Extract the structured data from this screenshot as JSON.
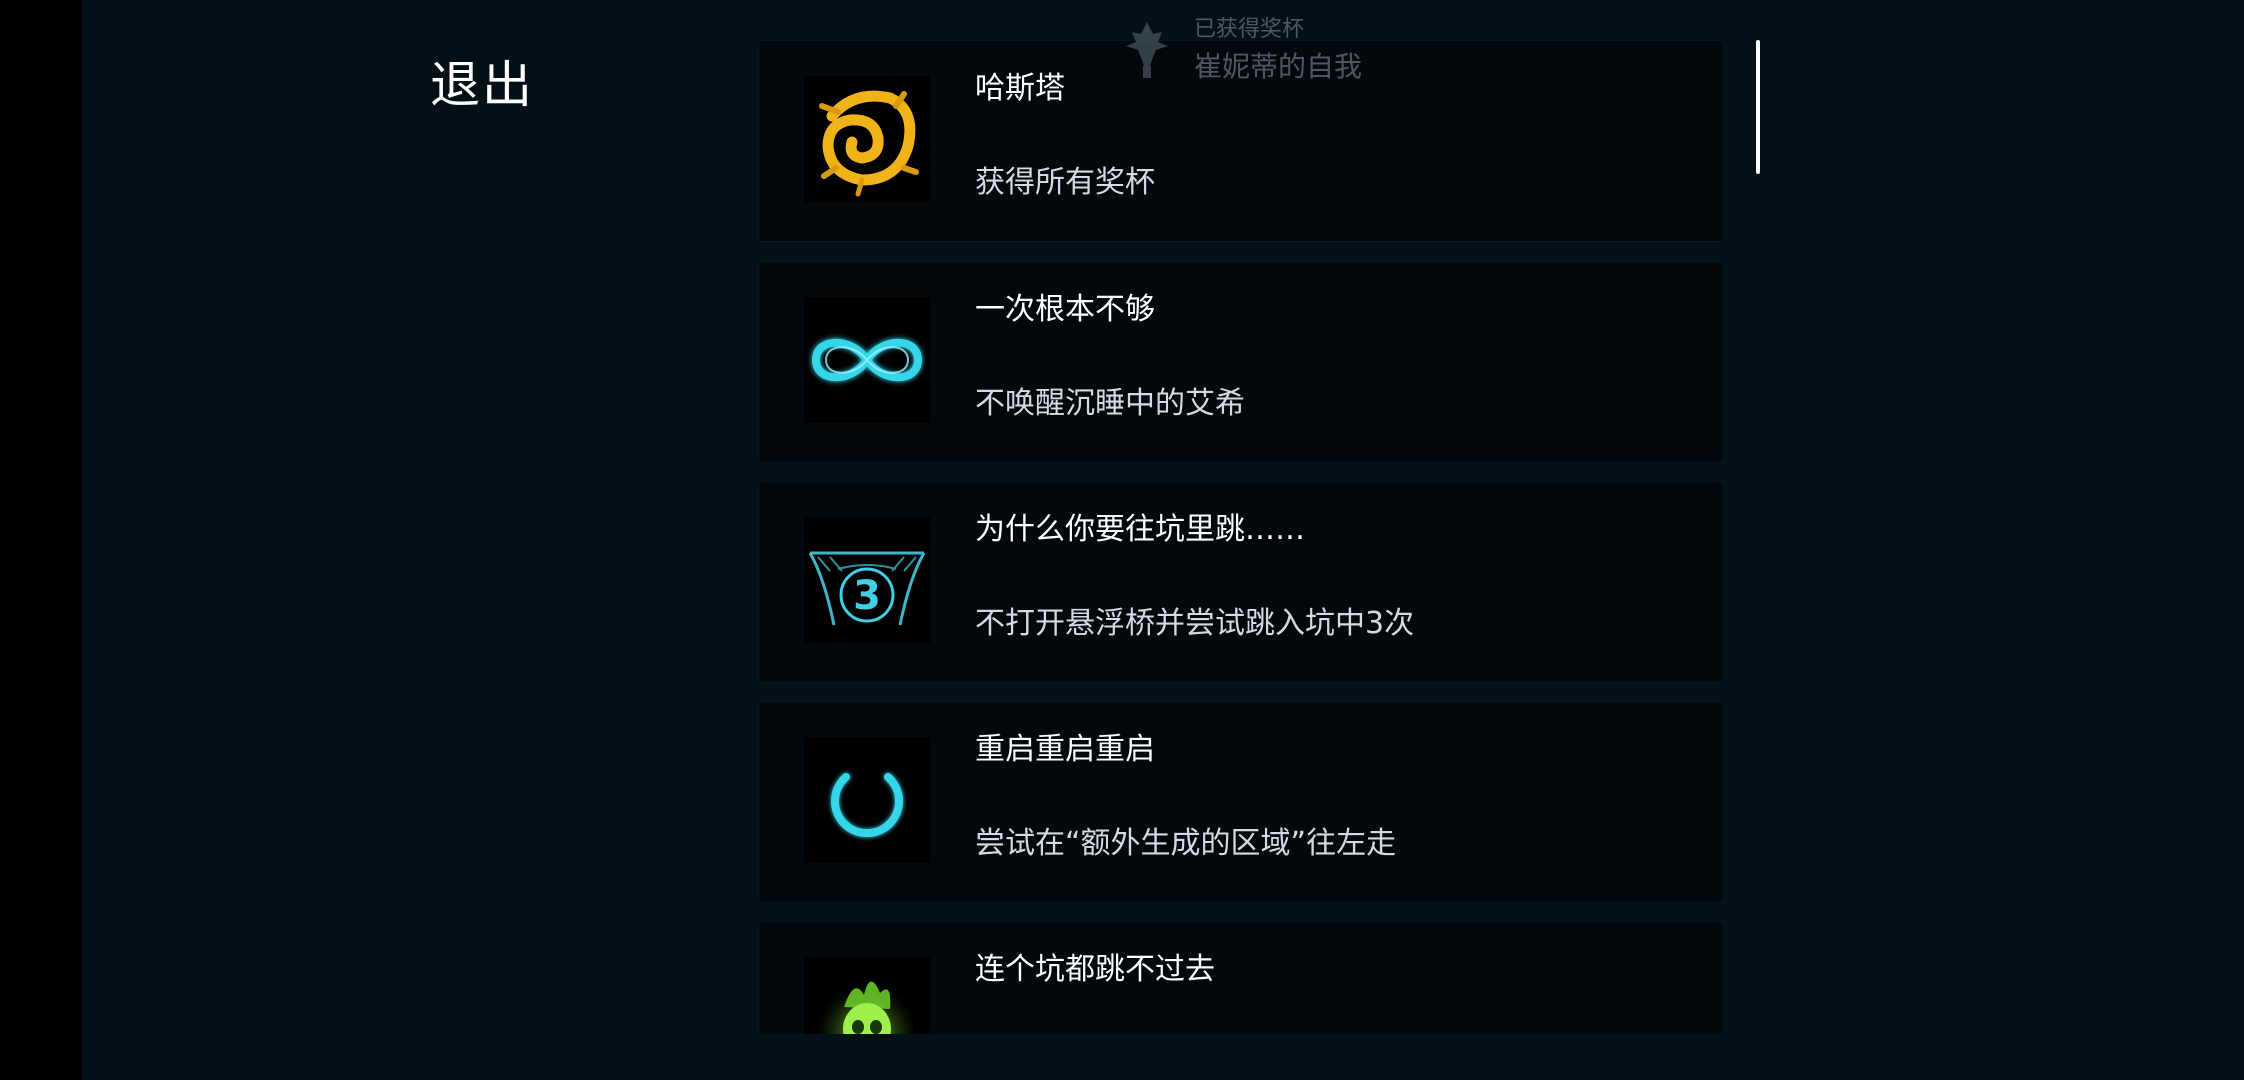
{
  "menu": {
    "exit_label": "退出"
  },
  "toast": {
    "caption": "已获得奖杯",
    "name": "崔妮蒂的自我"
  },
  "achievements": [
    {
      "title": "哈斯塔",
      "description": "获得所有奖杯",
      "icon": "golden-spiral-emblem-icon"
    },
    {
      "title": "一次根本不够",
      "description": "不唤醒沉睡中的艾希",
      "icon": "glowing-infinity-icon"
    },
    {
      "title": "为什么你要往坑里跳……",
      "description": "不打开悬浮桥并尝试跳入坑中3次",
      "icon": "bridge-pit-three-icon",
      "icon_text": "3"
    },
    {
      "title": "重启重启重启",
      "description": "尝试在“额外生成的区域”往左走",
      "icon": "power-button-icon"
    },
    {
      "title": "连个坑都跳不过去",
      "description": "",
      "icon": "green-flaming-skull-icon"
    }
  ],
  "colors": {
    "background": "#031018",
    "card": "#02080c",
    "cyan_glow": "#35d6ea",
    "gold": "#f0b418",
    "toxic_green": "#8ee63a"
  }
}
